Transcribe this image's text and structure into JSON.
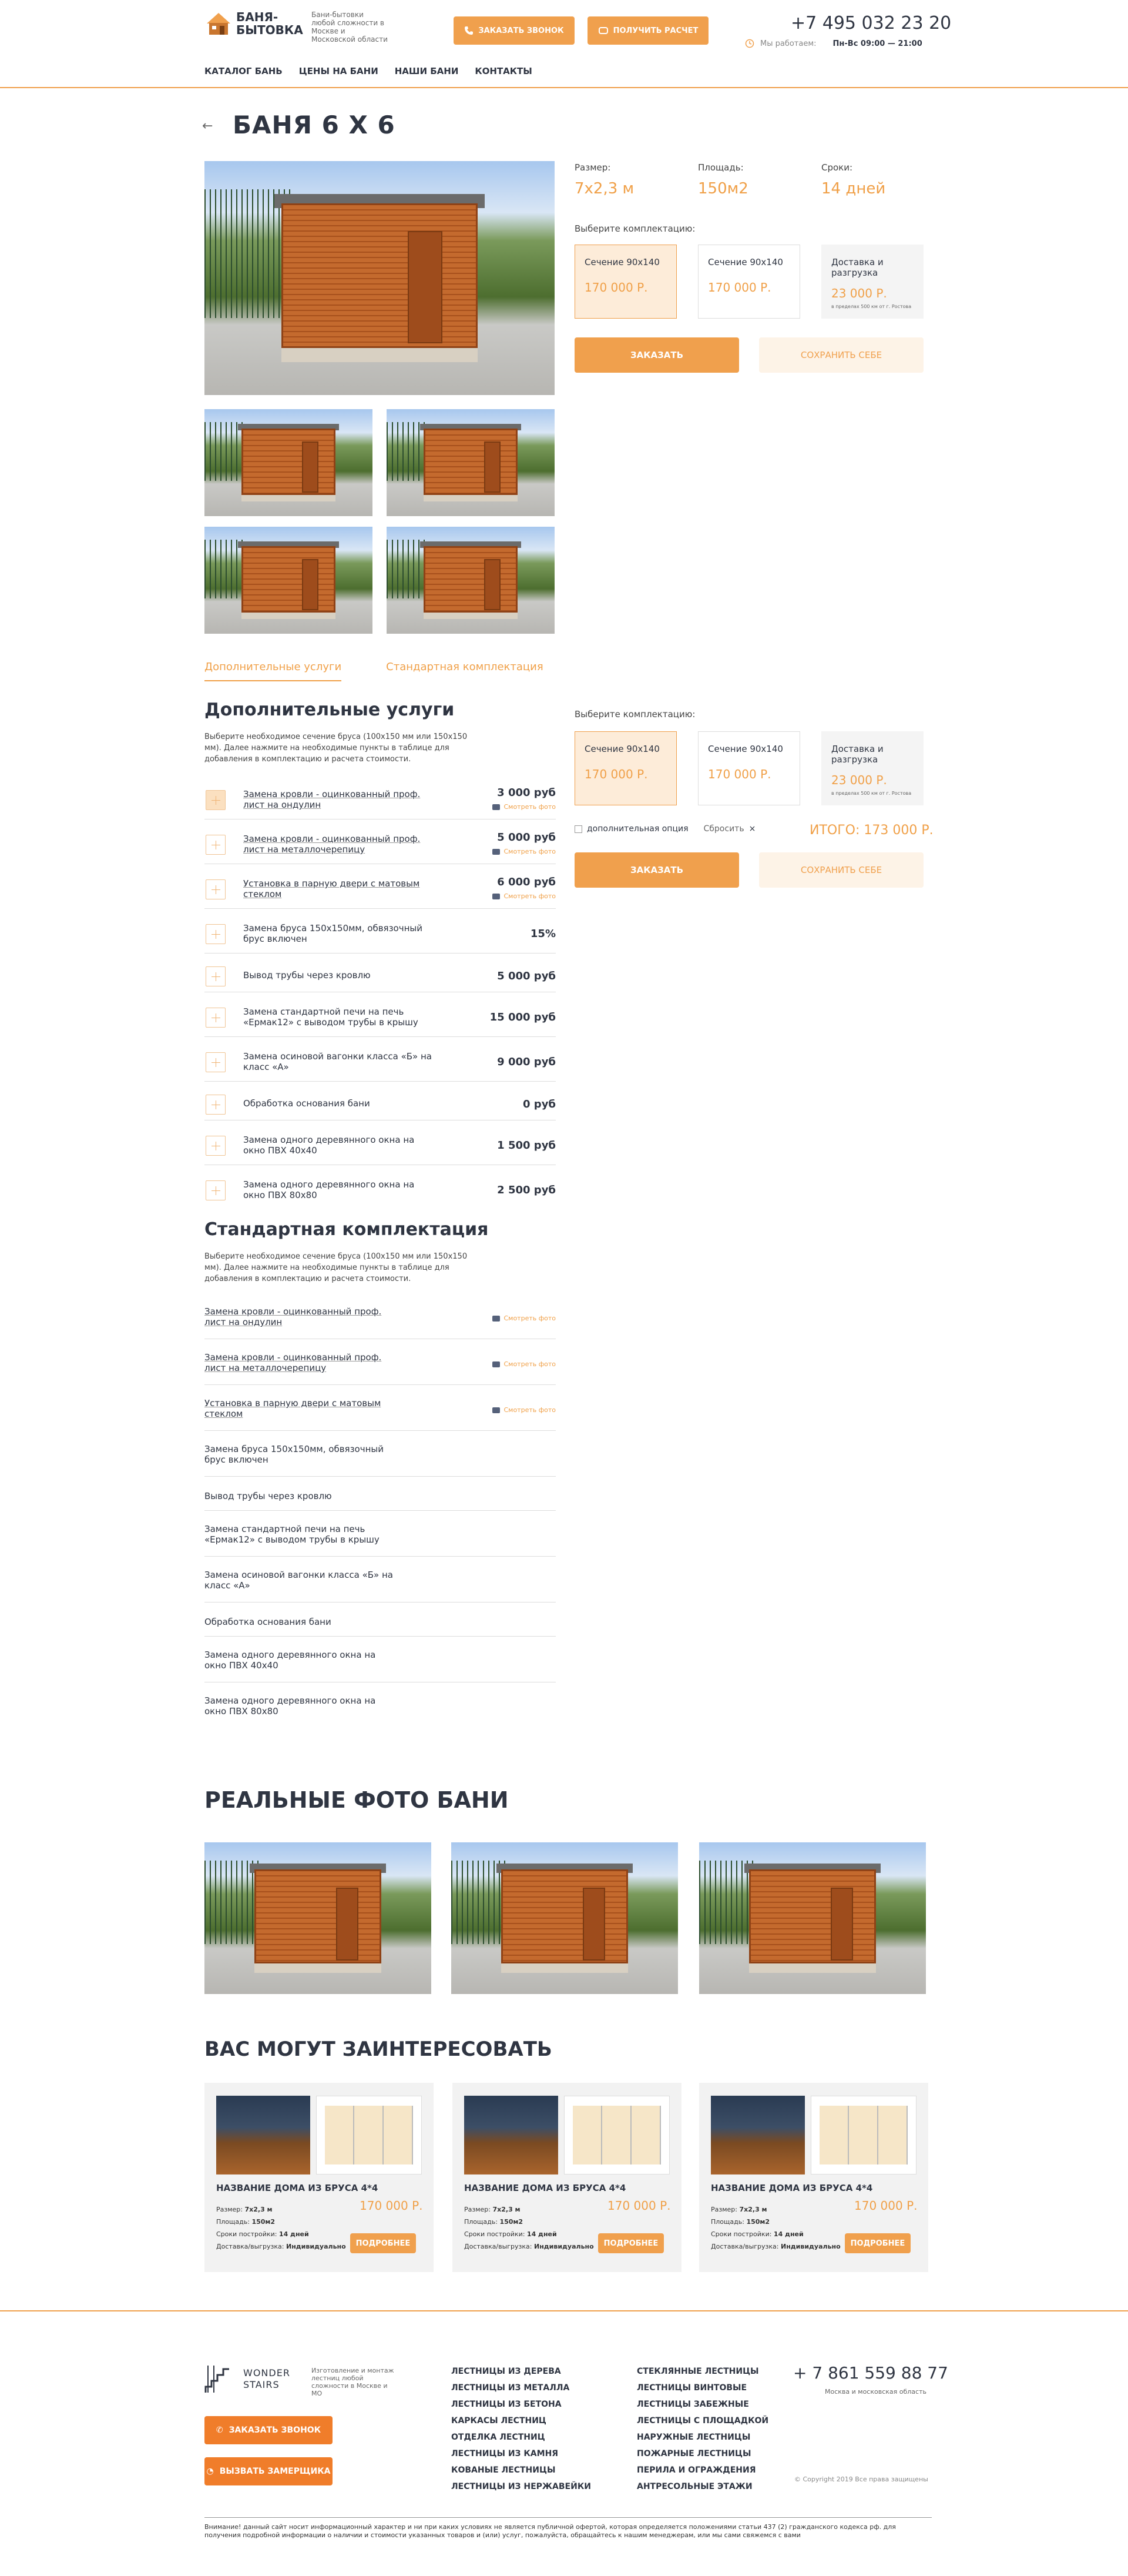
{
  "header": {
    "logo_line1": "БАНЯ-",
    "logo_line2": "БЫТОВКА",
    "logo_desc": "Бани-бытовки любой сложности в Москве и Московской области",
    "btn_call": "ЗАКАЗАТЬ ЗВОНОК",
    "btn_calc": "ПОЛУЧИТЬ РАСЧЕТ",
    "phone": "+7 495 032 23 20",
    "hours_label": "Мы работаем:",
    "hours_value": "Пн-Вс 09:00 — 21:00"
  },
  "nav": [
    "КАТАЛОГ БАНЬ",
    "ЦЕНЫ НА БАНИ",
    "НАШИ БАНИ",
    "КОНТАКТЫ"
  ],
  "product": {
    "title": "БАНЯ 6 Х 6",
    "specs": [
      {
        "label": "Размер:",
        "value": "7х2,3 м"
      },
      {
        "label": "Площадь:",
        "value": "150м2"
      },
      {
        "label": "Сроки:",
        "value": "14 дней"
      }
    ],
    "choose_label": "Выберите комплектацию:",
    "options": [
      {
        "name": "Сечение 90х140",
        "price": "170 000 Р."
      },
      {
        "name": "Сечение 90х140",
        "price": "170 000 Р."
      },
      {
        "name": "Доставка и разгрузка",
        "price": "23 000 Р.",
        "note": "в пределах 500 км от г. Ростова"
      }
    ],
    "btn_order": "ЗАКАЗАТЬ",
    "btn_save": "СОХРАНИТЬ СЕБЕ"
  },
  "tabs": [
    "Дополнительные услуги",
    "Стандартная комплектация"
  ],
  "extra": {
    "title": "Дополнительные услуги",
    "desc": "Выберите необходимое сечение бруса (100х150 мм или 150х150 мм). Далее нажмите на необходимые пункты в таблице для добавления в комплектацию и расчета стоимости.",
    "photo_label": "Смотреть фото",
    "items": [
      {
        "name": "Замена кровли - оцинкованный проф. лист на ондулин",
        "price": "3 000 руб"
      },
      {
        "name": "Замена кровли - оцинкованный проф. лист на металлочерепицу",
        "price": "5 000 руб"
      },
      {
        "name": "Установка в парную двери с матовым стеклом",
        "price": "6 000 руб"
      },
      {
        "name": "Замена бруса 150х150мм, обвязочный брус включен",
        "price": "15%"
      },
      {
        "name": "Вывод трубы через кровлю",
        "price": "5 000 руб"
      },
      {
        "name": "Замена стандартной печи на печь «Ермак12» с выводом трубы в крышу",
        "price": "15 000 руб"
      },
      {
        "name": "Замена осиновой вагонки класса «Б» на класс «А»",
        "price": "9 000 руб"
      },
      {
        "name": "Обработка основания бани",
        "price": "0 руб"
      },
      {
        "name": "Замена одного деревянного окна на окно ПВХ 40х40",
        "price": "1 500 руб"
      },
      {
        "name": "Замена одного деревянного окна на окно ПВХ 80х80",
        "price": "2 500 руб"
      }
    ]
  },
  "summary": {
    "extra_option": "дополнительная опция",
    "reset": "Сбросить",
    "total": "ИТОГО: 173 000 Р."
  },
  "standard": {
    "title": "Стандартная комплектация",
    "desc": "Выберите необходимое сечение бруса (100х150 мм или 150х150 мм). Далее нажмите на необходимые пункты в таблице для добавления в комплектацию и расчета стоимости.",
    "items": [
      "Замена кровли - оцинкованный проф. лист на ондулин",
      "Замена кровли - оцинкованный проф. лист на металлочерепицу",
      "Установка в парную двери с матовым стеклом",
      "Замена бруса 150х150мм, обвязочный брус включен",
      "Вывод трубы через кровлю",
      "Замена стандартной печи на печь «Ермак12» с выводом трубы в крышу",
      "Замена осиновой вагонки класса «Б» на класс «А»",
      "Обработка основания бани",
      "Замена одного деревянного окна на окно ПВХ 40х40",
      "Замена одного деревянного окна на окно ПВХ 80х80"
    ]
  },
  "real_photos_title": "РЕАЛЬНЫЕ ФОТО БАНИ",
  "interest": {
    "title": "ВАС МОГУТ ЗАИНТЕРЕСОВАТЬ",
    "card": {
      "name": "НАЗВАНИЕ ДОМА ИЗ БРУСА 4*4",
      "price": "170 000 Р.",
      "size_label": "Размер:",
      "size": "7х2,3 м",
      "area_label": "Площадь:",
      "area": "150м2",
      "term_label": "Сроки постройки:",
      "term": "14 дней",
      "delivery_label": "Доставка/выгрузка:",
      "delivery": "Индивидуально",
      "more": "ПОДРОБНЕЕ"
    }
  },
  "footer": {
    "logo_line1": "WONDER",
    "logo_line2": "STAIRS",
    "logo_desc": "Изготовление и монтаж лестниц любой сложности в Москве и МО",
    "btn_call": "ЗАКАЗАТЬ ЗВОНОК",
    "btn_measure": "ВЫЗВАТЬ ЗАМЕРЩИКА",
    "col1": [
      "ЛЕСТНИЦЫ ИЗ ДЕРЕВА",
      "ЛЕСТНИЦЫ ИЗ МЕТАЛЛА",
      "ЛЕСТНИЦЫ ИЗ БЕТОНА",
      "КАРКАСЫ ЛЕСТНИЦ",
      "ОТДЕЛКА ЛЕСТНИЦ",
      "ЛЕСТНИЦЫ ИЗ КАМНЯ",
      "КОВАНЫЕ ЛЕСТНИЦЫ",
      "ЛЕСТНИЦЫ ИЗ НЕРЖАВЕЙКИ"
    ],
    "col2": [
      "СТЕКЛЯННЫЕ ЛЕСТНИЦЫ",
      "ЛЕСТНИЦЫ ВИНТОВЫЕ",
      "ЛЕСТНИЦЫ ЗАБЕЖНЫЕ",
      "ЛЕСТНИЦЫ С ПЛОЩАДКОЙ",
      "НАРУЖНЫЕ ЛЕСТНИЦЫ",
      "ПОЖАРНЫЕ ЛЕСТНИЦЫ",
      "ПЕРИЛА И ОГРАЖДЕНИЯ",
      "АНТРЕСОЛЬНЫЕ ЭТАЖИ"
    ],
    "phone": "+ 7 861 559 88 77",
    "region": "Москва и московская область",
    "copyright": "© Copyright 2019 Все права защищены",
    "note": "Внимание! данный сайт носит информационный характер и ни при каких условиях не является публичной офертой, которая определяется положениями статьи 437 (2) гражданского кодекса рф. для получения подробной информации о наличии и стоимости указанных товаров и (или) услуг, пожалуйста, обращайтесь к нашим менеджерам, или мы сами свяжемся с вами"
  }
}
